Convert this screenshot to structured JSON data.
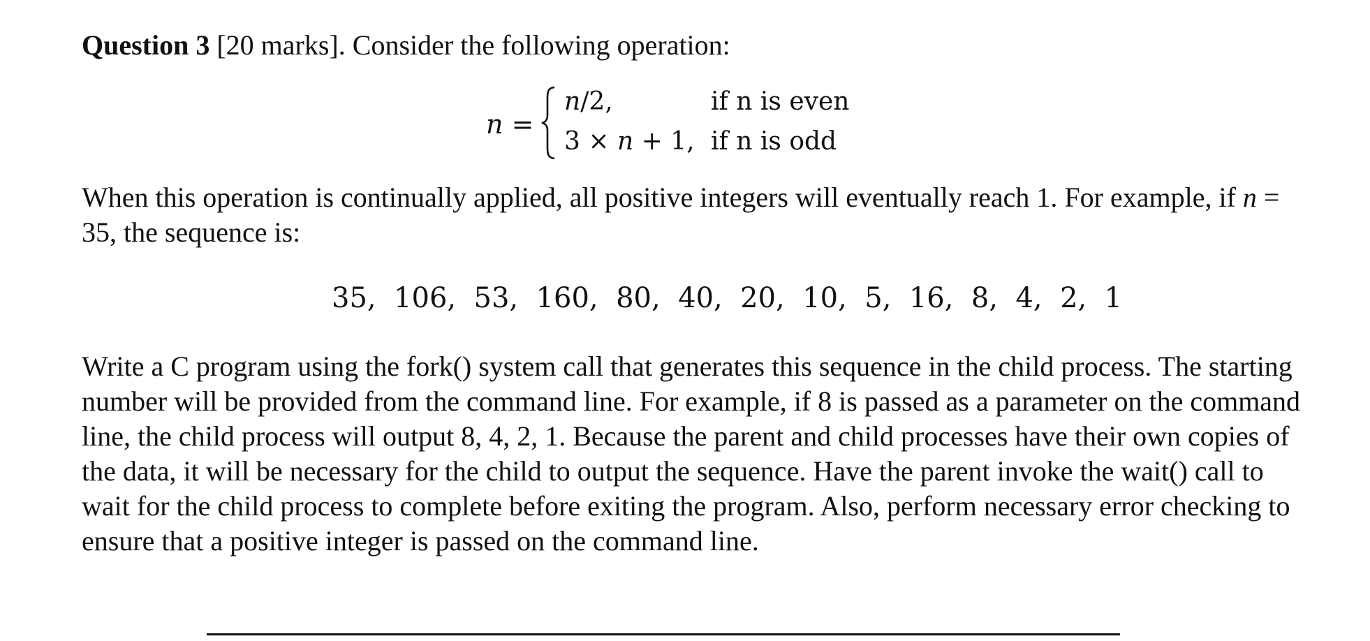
{
  "question": {
    "label": "Question 3",
    "marks": "[20 marks]",
    "intro": ". Consider the following operation:"
  },
  "equation": {
    "lhs_var": "n",
    "lhs_eq": " =",
    "case1_expr_var": "n",
    "case1_expr_rest": "/2,",
    "case1_cond": "if n is even",
    "case2_expr_pre": "3 × ",
    "case2_expr_var": "n",
    "case2_expr_post": " + 1,",
    "case2_cond": "if n is odd"
  },
  "example": {
    "text1": "When this operation is continually applied, all positive integers will eventually reach 1. For example, if ",
    "var": "n",
    "text2": " = 35, the sequence is:"
  },
  "sequence": {
    "text": "35,  106,  53,  160,  80,  40,  20,  10,  5,  16,  8,  4,  2,  1"
  },
  "body": {
    "text": "Write a C program using the fork() system call that generates this sequence in the child process. The starting number will be provided from the command line. For example, if 8 is passed as a parameter on the command line, the child process will output 8, 4, 2, 1. Because the parent and child processes have their own copies of the data, it will be necessary for the child to output the sequence. Have the parent invoke the wait() call to wait for the child process to complete before exiting the program. Also, perform necessary error checking to ensure that a positive integer is passed on the command line."
  }
}
